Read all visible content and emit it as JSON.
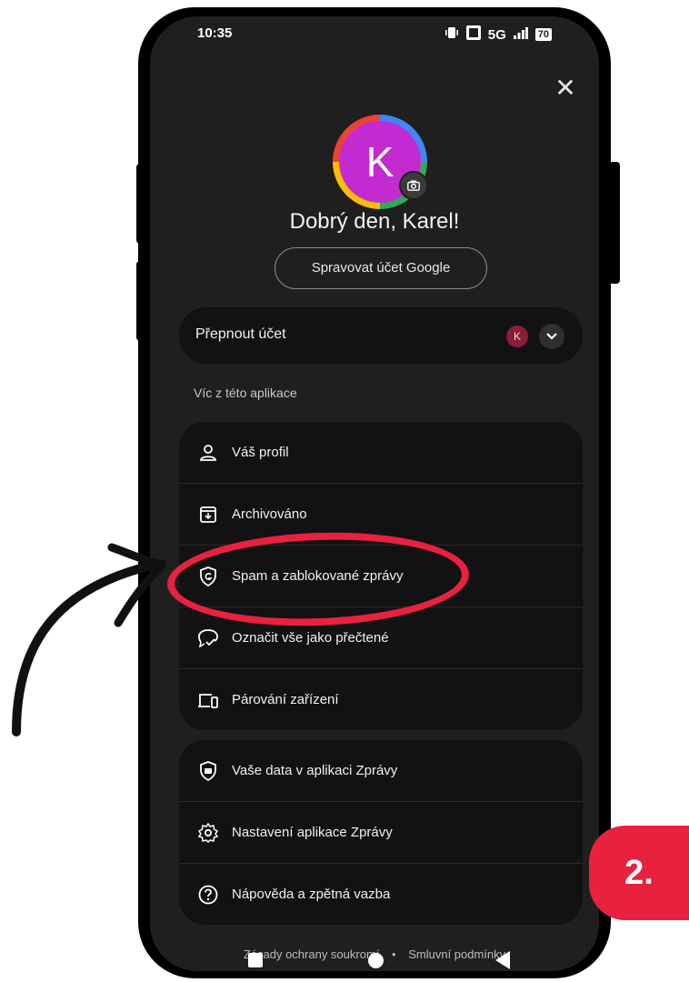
{
  "status_bar": {
    "time": "10:35",
    "network": "5G",
    "battery": "70"
  },
  "header": {
    "avatar_letter": "K",
    "greeting": "Dobrý den, Karel!",
    "manage_account": "Spravovat účet Google"
  },
  "account_switch": {
    "label": "Přepnout účet",
    "avatar_letter": "K"
  },
  "section_title": "Víc z této aplikace",
  "menu_group_1": [
    {
      "label": "Váš profil",
      "icon": "person-icon"
    },
    {
      "label": "Archivováno",
      "icon": "archive-icon"
    },
    {
      "label": "Spam a zablokované zprávy",
      "icon": "shield-icon"
    },
    {
      "label": "Označit vše jako přečtené",
      "icon": "mark-read-icon"
    },
    {
      "label": "Párování zařízení",
      "icon": "devices-icon"
    }
  ],
  "menu_group_2": [
    {
      "label": "Vaše data v aplikaci Zprávy",
      "icon": "data-shield-icon"
    },
    {
      "label": "Nastavení aplikace Zprávy",
      "icon": "gear-icon"
    },
    {
      "label": "Nápověda a zpětná vazba",
      "icon": "help-icon"
    }
  ],
  "footer": {
    "privacy": "Zásady ochrany soukromí",
    "separator": "•",
    "terms": "Smluvní podmínky"
  },
  "annotation": {
    "badge": "2.",
    "accent_color": "#e8213f"
  }
}
